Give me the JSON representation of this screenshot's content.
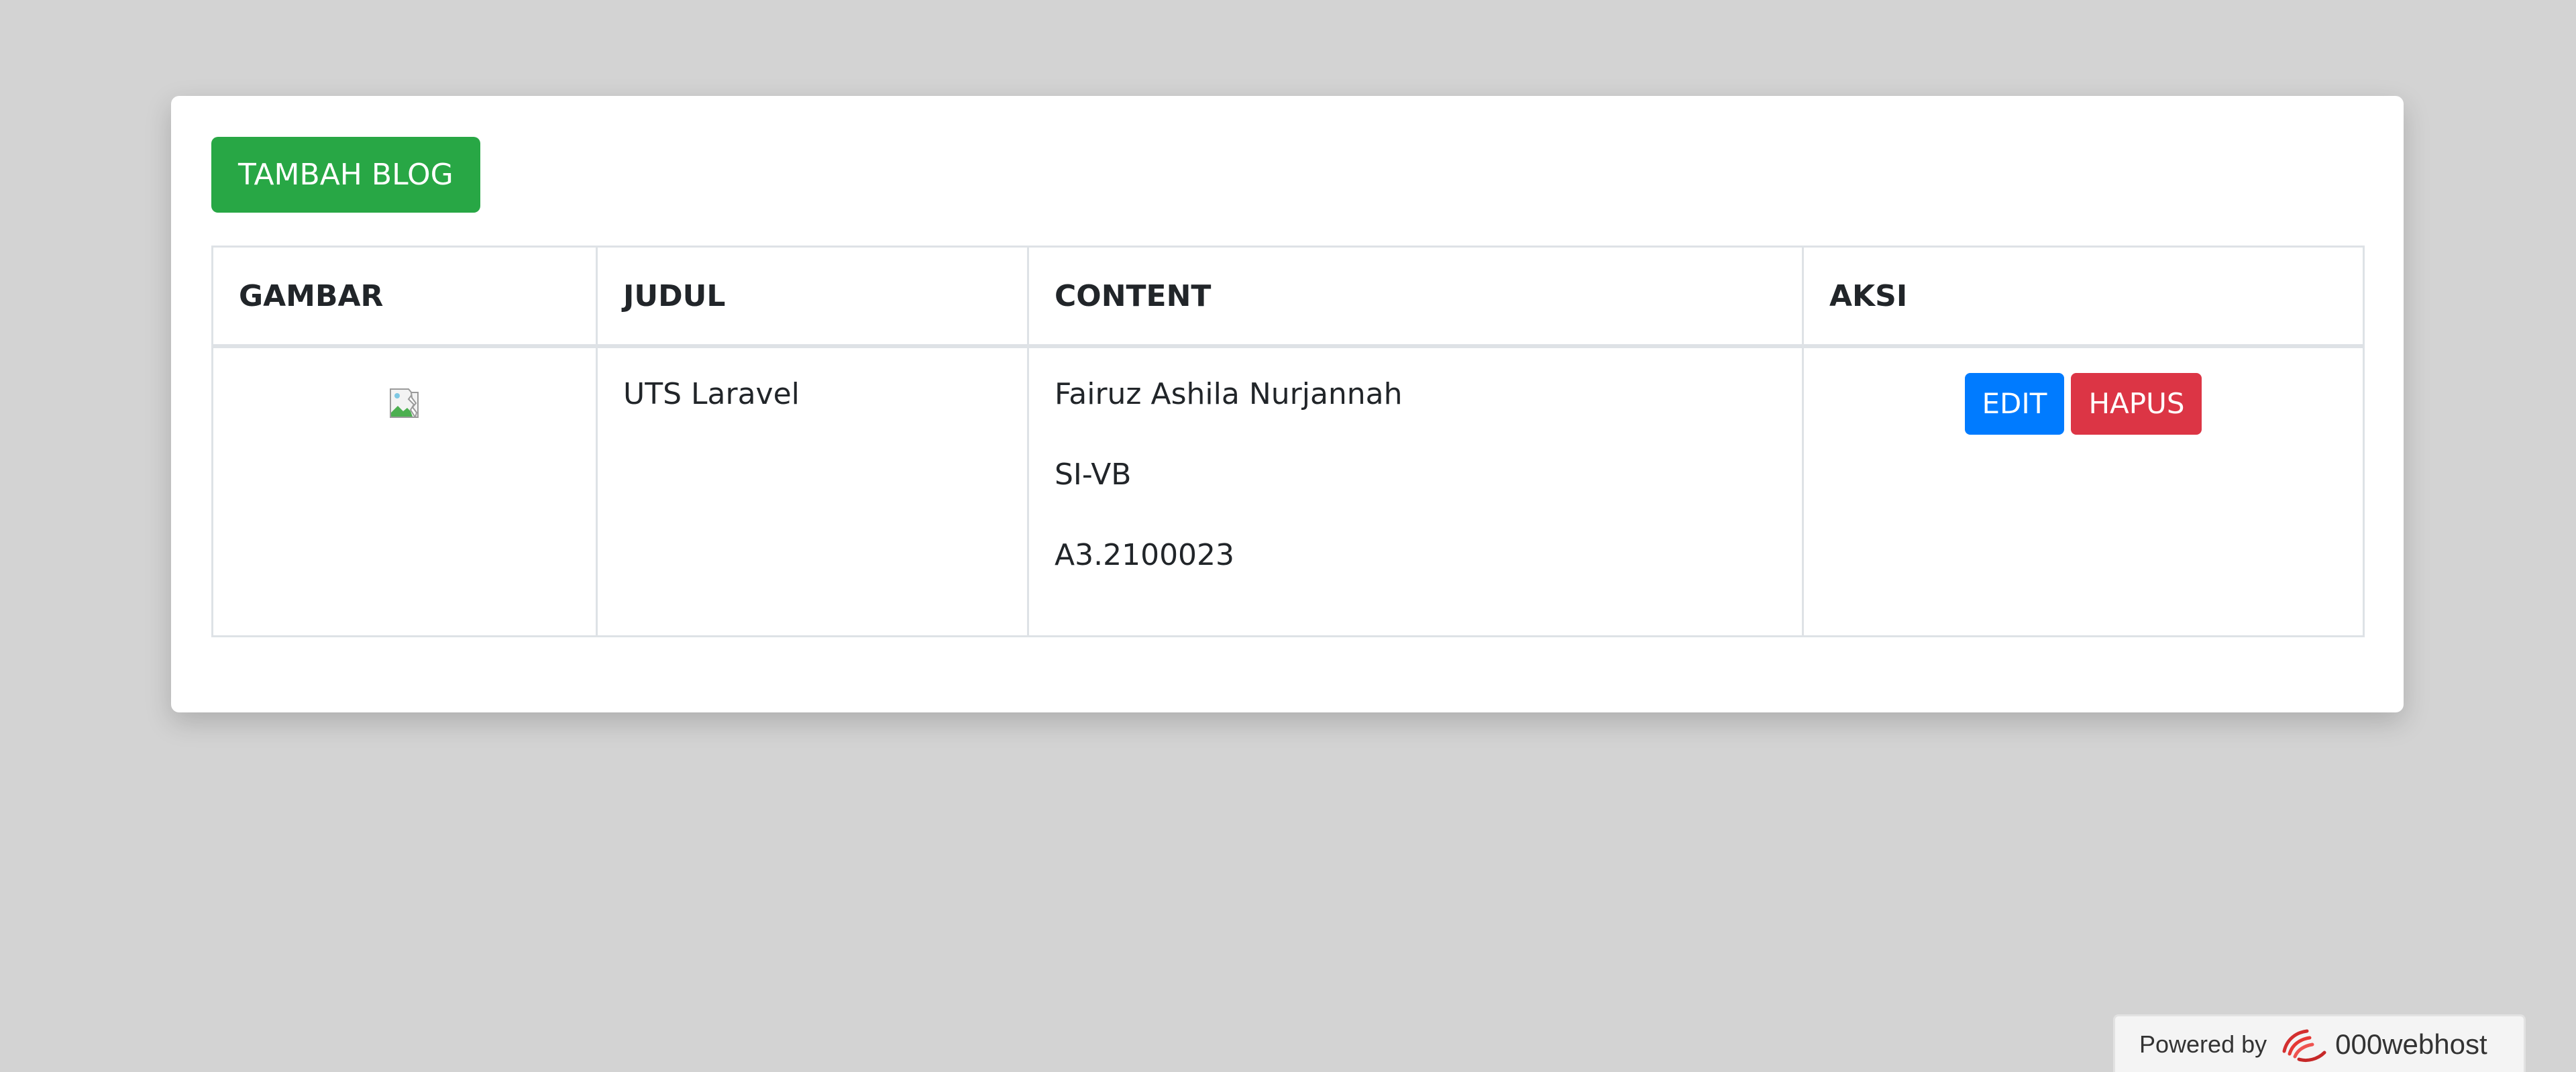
{
  "actions": {
    "add_blog_label": "TAMBAH BLOG"
  },
  "table": {
    "headers": {
      "image": "GAMBAR",
      "title": "JUDUL",
      "content": "CONTENT",
      "actions": "AKSI"
    },
    "rows": [
      {
        "title": "UTS Laravel",
        "content_lines": [
          "Fairuz Ashila Nurjannah",
          "SI-VB",
          "A3.2100023"
        ],
        "edit_label": "EDIT",
        "delete_label": "HAPUS"
      }
    ]
  },
  "footer": {
    "powered_by": "Powered by",
    "brand": "000webhost"
  },
  "colors": {
    "background": "#d3d3d3",
    "add_button": "#28a745",
    "edit_button": "#007bff",
    "delete_button": "#dc3545"
  },
  "icons": {
    "image_placeholder": "broken-image-icon",
    "brand_logo": "000webhost-logo-icon"
  }
}
